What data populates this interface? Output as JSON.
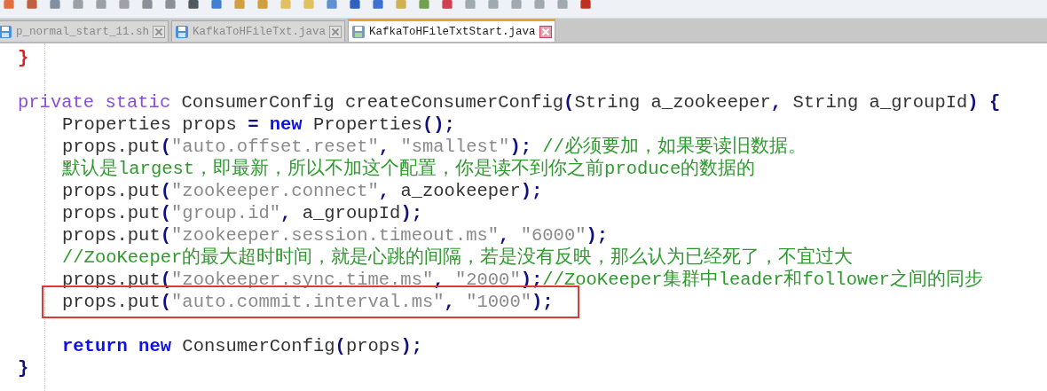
{
  "tabs": [
    {
      "label": "p_normal_start_11.sh",
      "selected": false
    },
    {
      "label": "KafkaToHFileTxt.java",
      "selected": false
    },
    {
      "label": "KafkaToHFileTxtStart.java",
      "selected": true
    }
  ],
  "editor": {
    "lines": [
      {
        "boxed": false,
        "tokens": [
          {
            "kind": "brace",
            "text": "}"
          }
        ]
      },
      {
        "boxed": false
      },
      {
        "boxed": false,
        "tokens": [
          {
            "kind": "modifier",
            "text": "private static"
          },
          {
            "kind": "plain",
            "text": " ConsumerConfig createConsumerConfig"
          },
          {
            "kind": "operator",
            "text": "("
          },
          {
            "kind": "plain",
            "text": "String a_zookeeper"
          },
          {
            "kind": "operator",
            "text": ","
          },
          {
            "kind": "plain",
            "text": " String a_groupId"
          },
          {
            "kind": "operator",
            "text": ") {"
          }
        ],
        "children": [
          {
            "boxed": false,
            "tokens": [
              {
                "kind": "plain",
                "text": "Properties props "
              },
              {
                "kind": "operator",
                "text": "="
              },
              {
                "kind": "keyword",
                "text": " new"
              },
              {
                "kind": "plain",
                "text": " Properties"
              },
              {
                "kind": "operator",
                "text": "();"
              }
            ]
          },
          {
            "boxed": false,
            "tokens": [
              {
                "kind": "plain",
                "text": "props.put"
              },
              {
                "kind": "operator",
                "text": "("
              },
              {
                "kind": "string",
                "text": "\"auto.offset.reset\""
              },
              {
                "kind": "operator",
                "text": ","
              },
              {
                "kind": "string",
                "text": " \"smallest\""
              },
              {
                "kind": "operator",
                "text": ");"
              },
              {
                "kind": "comment",
                "text": " //必须要加，如果要读旧数据。"
              }
            ]
          },
          {
            "boxed": false,
            "tokens": [
              {
                "kind": "comment",
                "text": "默认是largest，即最新，所以不加这个配置，你是读不到你之前produce的数据的"
              }
            ]
          },
          {
            "boxed": false,
            "tokens": [
              {
                "kind": "plain",
                "text": "props.put"
              },
              {
                "kind": "operator",
                "text": "("
              },
              {
                "kind": "string",
                "text": "\"zookeeper.connect\""
              },
              {
                "kind": "operator",
                "text": ","
              },
              {
                "kind": "plain",
                "text": " a_zookeeper"
              },
              {
                "kind": "operator",
                "text": ");"
              }
            ]
          },
          {
            "boxed": false,
            "tokens": [
              {
                "kind": "plain",
                "text": "props.put"
              },
              {
                "kind": "operator",
                "text": "("
              },
              {
                "kind": "string",
                "text": "\"group.id\""
              },
              {
                "kind": "operator",
                "text": ","
              },
              {
                "kind": "plain",
                "text": " a_groupId"
              },
              {
                "kind": "operator",
                "text": ");"
              }
            ]
          },
          {
            "boxed": false,
            "tokens": [
              {
                "kind": "plain",
                "text": "props.put"
              },
              {
                "kind": "operator",
                "text": "("
              },
              {
                "kind": "string",
                "text": "\"zookeeper.session.timeout.ms\""
              },
              {
                "kind": "operator",
                "text": ","
              },
              {
                "kind": "string",
                "text": " \"6000\""
              },
              {
                "kind": "operator",
                "text": ");"
              }
            ]
          },
          {
            "boxed": false,
            "tokens": [
              {
                "kind": "comment",
                "text": "//ZooKeeper的最大超时时间，就是心跳的间隔，若是没有反映，那么认为已经死了，不宜过大"
              }
            ]
          },
          {
            "boxed": false,
            "tokens": [
              {
                "kind": "plain",
                "text": "props.put"
              },
              {
                "kind": "operator",
                "text": "("
              },
              {
                "kind": "string",
                "text": "\"zookeeper.sync.time.ms\""
              },
              {
                "kind": "operator",
                "text": ","
              },
              {
                "kind": "string",
                "text": " \"2000\""
              },
              {
                "kind": "operator",
                "text": ");"
              },
              {
                "kind": "comment",
                "text": "//ZooKeeper集群中leader和follower之间的同步"
              }
            ]
          },
          {
            "boxed": true,
            "tokens": [
              {
                "kind": "plain",
                "text": "props.put"
              },
              {
                "kind": "operator",
                "text": "("
              },
              {
                "kind": "string",
                "text": "\"auto.commit.interval.ms\""
              },
              {
                "kind": "operator",
                "text": ","
              },
              {
                "kind": "string",
                "text": " \"1000\""
              },
              {
                "kind": "operator",
                "text": ");"
              }
            ]
          },
          {
            "boxed": false
          },
          {
            "boxed": false,
            "tokens": [
              {
                "kind": "keyword",
                "text": "return"
              },
              {
                "kind": "keyword",
                "text": " new"
              },
              {
                "kind": "plain",
                "text": " ConsumerConfig"
              },
              {
                "kind": "operator",
                "text": "("
              },
              {
                "kind": "plain",
                "text": "props"
              },
              {
                "kind": "operator",
                "text": ");"
              }
            ]
          }
        ]
      },
      {
        "boxed": false,
        "tokens": [
          {
            "kind": "operator",
            "text": "}"
          }
        ]
      }
    ]
  }
}
